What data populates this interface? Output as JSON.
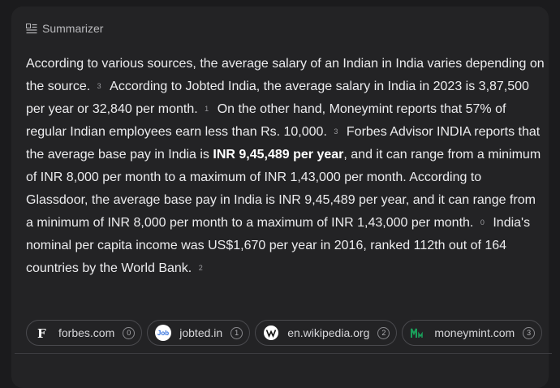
{
  "summarizer": {
    "title": "Summarizer",
    "icon": "summary-list-icon"
  },
  "summary": {
    "s1": "According to various sources, the average salary of an Indian in India varies depending on the source.",
    "c1": "3",
    "s2": "According to Jobted India, the average salary in India in 2023 is 3,87,500 per year or 32,840 per month.",
    "c2": "1",
    "s3": "On the other hand, Moneymint reports that 57% of regular Indian employees earn less than Rs. 10,000.",
    "c3": "3",
    "s4a": "Forbes Advisor INDIA reports that the average base pay in India is",
    "s4bold": "INR 9,45,489 per year",
    "s4b": ", and it can range from a minimum of INR 8,000 per month to a maximum of INR 1,43,000 per month. According to Glassdoor, the average base pay in India is INR 9,45,489 per year, and it can range from a minimum of INR 8,000 per month to a maximum of INR 1,43,000 per month.",
    "c4": "0",
    "s5": "India's nominal per capita income was US$1,670 per year in 2016, ranked 112th out of 164 countries by the World Bank.",
    "c5": "2"
  },
  "sources": [
    {
      "label": "forbes.com",
      "num": "0",
      "icon": "forbes-logo-icon"
    },
    {
      "label": "jobted.in",
      "num": "1",
      "icon": "jobted-logo-icon",
      "logo_text": "Job"
    },
    {
      "label": "en.wikipedia.org",
      "num": "2",
      "icon": "wikipedia-logo-icon"
    },
    {
      "label": "moneymint.com",
      "num": "3",
      "icon": "moneymint-logo-icon"
    }
  ],
  "colors": {
    "background": "#1b1b1d",
    "card": "#232325",
    "text": "#ececee",
    "jobted_blue": "#2f6fde",
    "moneymint_green": "#1a9f5a"
  }
}
